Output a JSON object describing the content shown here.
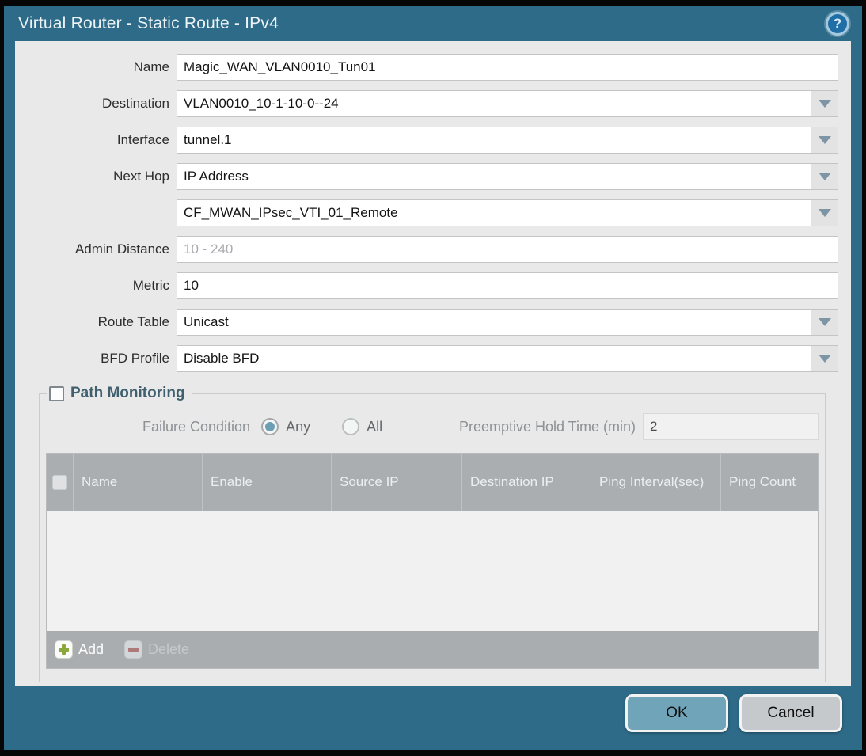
{
  "dialog": {
    "title": "Virtual Router - Static Route - IPv4",
    "help_glyph": "?"
  },
  "form": {
    "name": {
      "label": "Name",
      "value": "Magic_WAN_VLAN0010_Tun01"
    },
    "destination": {
      "label": "Destination",
      "value": "VLAN0010_10-1-10-0--24"
    },
    "interface": {
      "label": "Interface",
      "value": "tunnel.1"
    },
    "next_hop": {
      "label": "Next Hop",
      "value": "IP Address"
    },
    "next_hop_address": {
      "value": "CF_MWAN_IPsec_VTI_01_Remote"
    },
    "admin_distance": {
      "label": "Admin Distance",
      "placeholder": "10 - 240",
      "value": ""
    },
    "metric": {
      "label": "Metric",
      "value": "10"
    },
    "route_table": {
      "label": "Route Table",
      "value": "Unicast"
    },
    "bfd_profile": {
      "label": "BFD Profile",
      "value": "Disable BFD"
    }
  },
  "path_monitoring": {
    "title": "Path Monitoring",
    "checkbox_checked": false,
    "failure_condition": {
      "label": "Failure Condition",
      "options": [
        "Any",
        "All"
      ],
      "selected": "Any"
    },
    "preemptive_hold_time": {
      "label": "Preemptive Hold Time (min)",
      "value": "2",
      "disabled": true
    },
    "table": {
      "columns": [
        "Name",
        "Enable",
        "Source IP",
        "Destination IP",
        "Ping Interval(sec)",
        "Ping Count"
      ],
      "rows": []
    },
    "add_label": "Add",
    "delete_label": "Delete"
  },
  "footer": {
    "ok_label": "OK",
    "cancel_label": "Cancel"
  },
  "colors": {
    "titlebar_teal": "#2e6b88",
    "content_bg": "#e9e9e9",
    "table_header_bg": "#abaeb1",
    "table_footer_bg": "#a9adb0",
    "ok_button_bg": "#6fa4b9",
    "cancel_button_bg": "#c6c9cc",
    "radio_selected_dot": "#6c9eb4",
    "add_plus_green": "#8aa83c",
    "delete_minus_red": "#a2595a",
    "dropdown_arrow": "#7e95a6"
  }
}
